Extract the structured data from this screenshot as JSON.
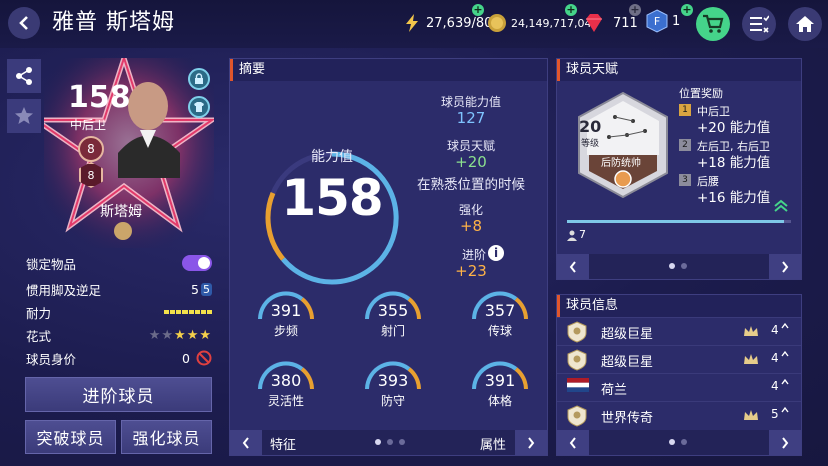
{
  "header": {
    "back_icon": "chevron-left-icon",
    "title": "雅普 斯塔姆",
    "energy": "27,639/80",
    "coins": "24,149,717,049",
    "gems": "711",
    "tokens": "1",
    "colors": {
      "accent_green": "#45d48a",
      "accent_orange": "#e0562c"
    }
  },
  "card": {
    "ovr": "158",
    "position": "中后卫",
    "rank_top": "8",
    "rank_bottom": "8",
    "name": "斯塔姆"
  },
  "player_props": {
    "lock_label": "锁定物品",
    "lock_on": true,
    "foot_label": "惯用脚及逆足",
    "foot_strong": "5",
    "foot_weak": "5",
    "stamina_label": "耐力",
    "stamina_level": 1.0,
    "skill_label": "花式",
    "skill_stars": 3,
    "skill_stars_max": 5,
    "value_label": "球员身价",
    "value": "0"
  },
  "buttons": {
    "advance": "进阶球员",
    "breakthrough": "突破球员",
    "enhance": "强化球员"
  },
  "summary": {
    "title": "摘要",
    "ovr_label": "能力值",
    "ovr": "158",
    "base_label": "球员能力值",
    "base": "127",
    "talent_label": "球员天赋",
    "talent": "+20",
    "talent_note": "在熟悉位置的时候",
    "enhance_label": "强化",
    "enhance": "+8",
    "advance_label": "进阶",
    "advance": "+23",
    "stats": [
      {
        "value": "391",
        "label": "步频"
      },
      {
        "value": "355",
        "label": "射门"
      },
      {
        "value": "357",
        "label": "传球"
      },
      {
        "value": "380",
        "label": "灵活性"
      },
      {
        "value": "393",
        "label": "防守"
      },
      {
        "value": "391",
        "label": "体格"
      }
    ],
    "footer_left": "特征",
    "footer_right": "属性"
  },
  "talent": {
    "title": "球员天赋",
    "level": "20",
    "level_label": "等级",
    "talent_name": "后防统帅",
    "bonus_title": "位置奖励",
    "bonuses": [
      {
        "rank": "1",
        "pos": "中后卫",
        "value": "+20 能力值"
      },
      {
        "rank": "2",
        "pos": "左后卫, 右后卫",
        "value": "+18 能力值"
      },
      {
        "rank": "3",
        "pos": "后腰",
        "value": "+16 能力值"
      }
    ],
    "progress": 0.97,
    "count": "7"
  },
  "info": {
    "title": "球员信息",
    "rows": [
      {
        "label": "超级巨星",
        "count": "4"
      },
      {
        "label": "超级巨星",
        "count": "4"
      },
      {
        "label": "荷兰",
        "count": "4"
      },
      {
        "label": "世界传奇",
        "count": "5"
      }
    ]
  }
}
